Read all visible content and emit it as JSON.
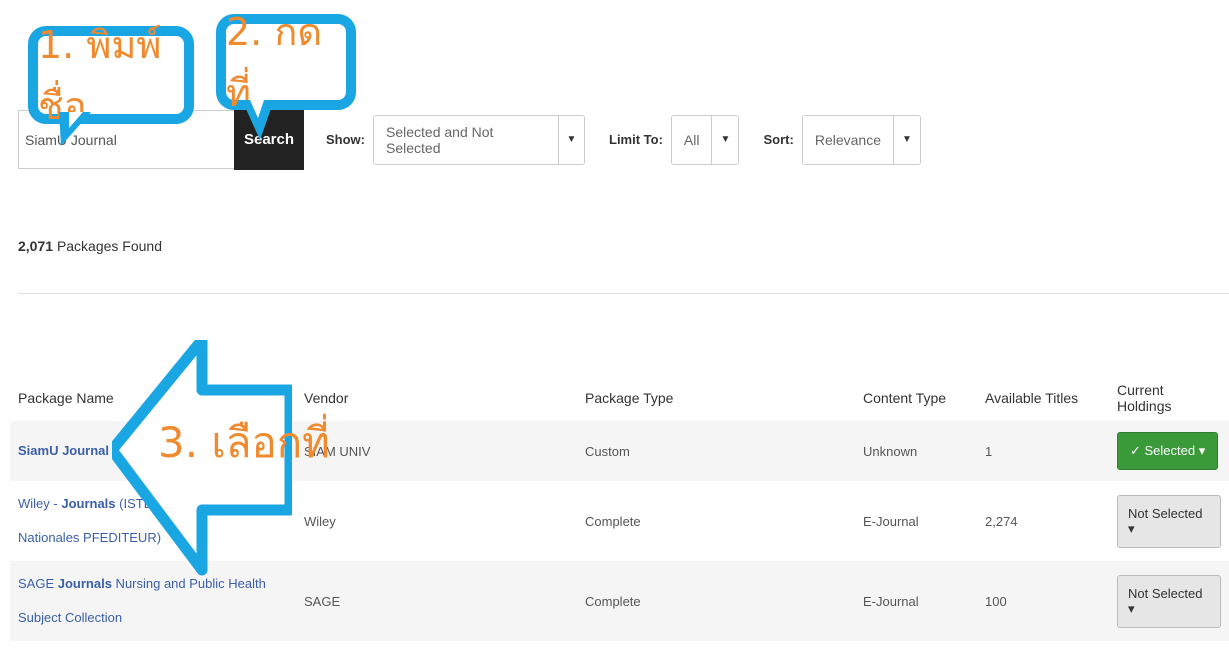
{
  "search": {
    "value": "SiamU Journal",
    "button_label": "Search"
  },
  "filters": {
    "show_label": "Show:",
    "show_value": "Selected and Not Selected",
    "limit_label": "Limit To:",
    "limit_value": "All",
    "sort_label": "Sort:",
    "sort_value": "Relevance"
  },
  "results": {
    "count": "2,071",
    "count_suffix": "Packages Found"
  },
  "table": {
    "headers": [
      "Package Name",
      "Vendor",
      "Package Type",
      "Content Type",
      "Available Titles",
      "Current Holdings"
    ],
    "rows": [
      {
        "name_bold": "SiamU Journal",
        "name_rest": "",
        "vendor": "SIAM UNIV",
        "package_type": "Custom",
        "content_type": "Unknown",
        "titles": "1",
        "holdings": "✓ Selected ▾"
      },
      {
        "name_pre": "Wiley - ",
        "name_bold": "Journals",
        "name_rest": " (ISTEX - Licences Nationales PFEDITEUR)",
        "vendor": "Wiley",
        "package_type": "Complete",
        "content_type": "E-Journal",
        "titles": "2,274",
        "holdings": "Not Selected ▾"
      },
      {
        "name_pre": "SAGE ",
        "name_bold": "Journals",
        "name_rest": " Nursing and Public Health Subject Collection",
        "vendor": "SAGE",
        "package_type": "Complete",
        "content_type": "E-Journal",
        "titles": "100",
        "holdings": "Not Selected ▾"
      }
    ]
  },
  "annotations": {
    "step1": "1. พิมพ์ชื่อ",
    "step2": "2. กดที่",
    "step3": "3. เลือกที่"
  },
  "colors": {
    "callout": "#1aa6e3",
    "callout_text": "#f08a2e",
    "selected_green": "#3a9a3a",
    "link": "#3a5fa8"
  }
}
